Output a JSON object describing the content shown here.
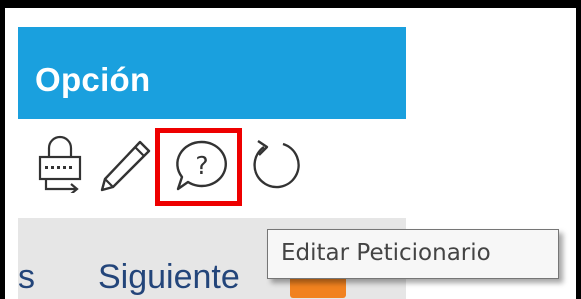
{
  "panel": {
    "title": "Opción"
  },
  "toolbar": {
    "icons": [
      "lock-icon",
      "pencil-icon",
      "help-icon",
      "refresh-icon"
    ],
    "highlighted": "help-icon",
    "highlight_color": "#ee0000"
  },
  "navigation": {
    "previous_partial": "s",
    "next_label": "Siguiente"
  },
  "tooltip": {
    "text": "Editar Peticionario"
  },
  "colors": {
    "header": "#1aa0de",
    "nav_text": "#23457a",
    "next_accent": "#f1821f"
  }
}
